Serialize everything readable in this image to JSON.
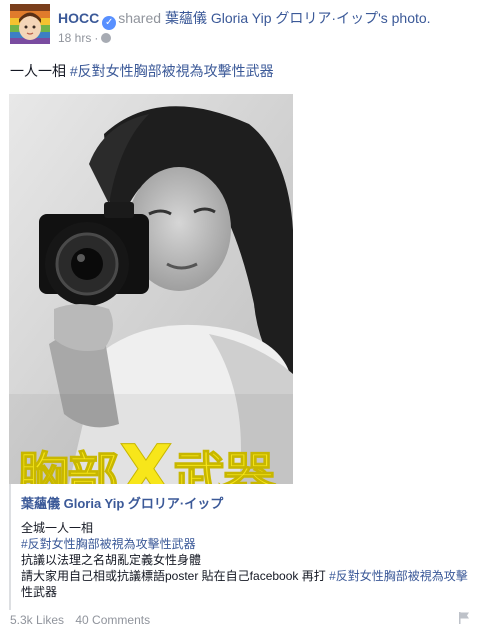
{
  "header": {
    "author": "HOCC",
    "action": "shared",
    "page": "葉蘊儀 Gloria Yip グロリア·イップ",
    "suffix": "'s photo.",
    "time": "18 hrs",
    "dot": "·"
  },
  "post": {
    "caption_text": "一人一相",
    "caption_hashtag": "#反對女性胸部被視為攻擊性武器"
  },
  "photo": {
    "overlay_left": "胸部",
    "overlay_x": "X",
    "overlay_right": "武器"
  },
  "shared_post": {
    "title": "葉蘊儀 Gloria Yip グロリア·イップ",
    "line1": "全城一人一相",
    "line2": "#反對女性胸部被視為攻擊性武器",
    "line3": "抗議以法理之名胡亂定義女性身體",
    "line4_prefix": "請大家用自己相或抗議標語poster 貼在自己facebook 再打 ",
    "line4_hashtag": "#反對女性胸部被視為攻擊",
    "line5": "性武器"
  },
  "footer": {
    "likes": "5.3k Likes",
    "comments": "40 Comments"
  },
  "icons": [
    "verified-icon",
    "globe-icon",
    "flag-icon"
  ],
  "colors": {
    "link": "#3b5998",
    "muted": "#90949c",
    "overlay": "#f7e61a"
  }
}
